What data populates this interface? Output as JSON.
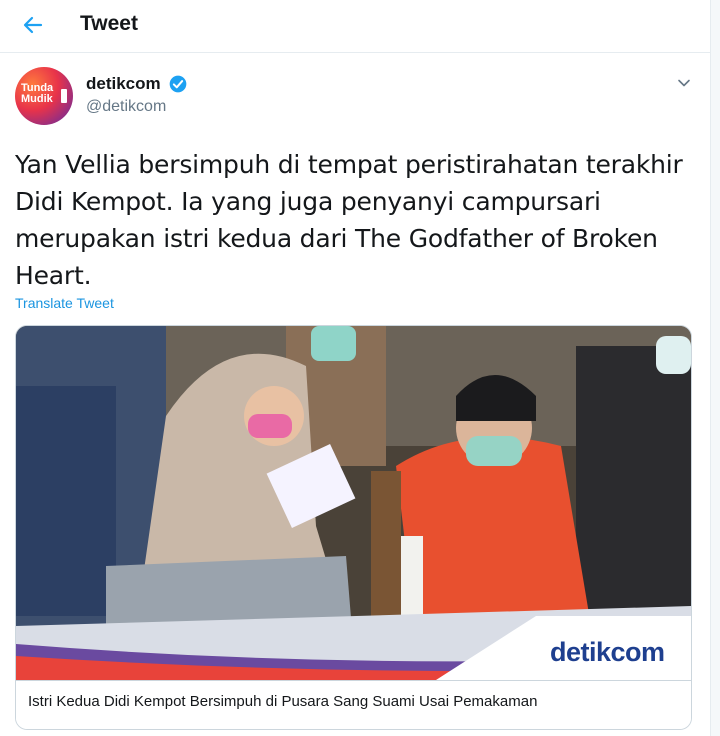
{
  "header": {
    "title": "Tweet",
    "back_icon": "arrow-left-icon",
    "accent_color": "#1da1f2"
  },
  "author": {
    "avatar_line1": "Tunda",
    "avatar_line2": "Mudik",
    "name": "detikcom",
    "handle": "@detikcom",
    "verified": true
  },
  "tweet": {
    "text": "Yan Vellia bersimpuh di tempat peristirahatan terakhir Didi Kempot. Ia yang juga penyanyi campursari merupakan istri kedua dari The Godfather of Broken Heart.",
    "translate_label": "Translate Tweet"
  },
  "card": {
    "logo_text": "detikcom",
    "caption": "Istri Kedua Didi Kempot Bersimpuh di Pusara Sang Suami Usai Pemakaman"
  },
  "colors": {
    "link": "#1b95e0",
    "text": "#14171a",
    "muted": "#657786",
    "border": "#e6ecf0"
  }
}
